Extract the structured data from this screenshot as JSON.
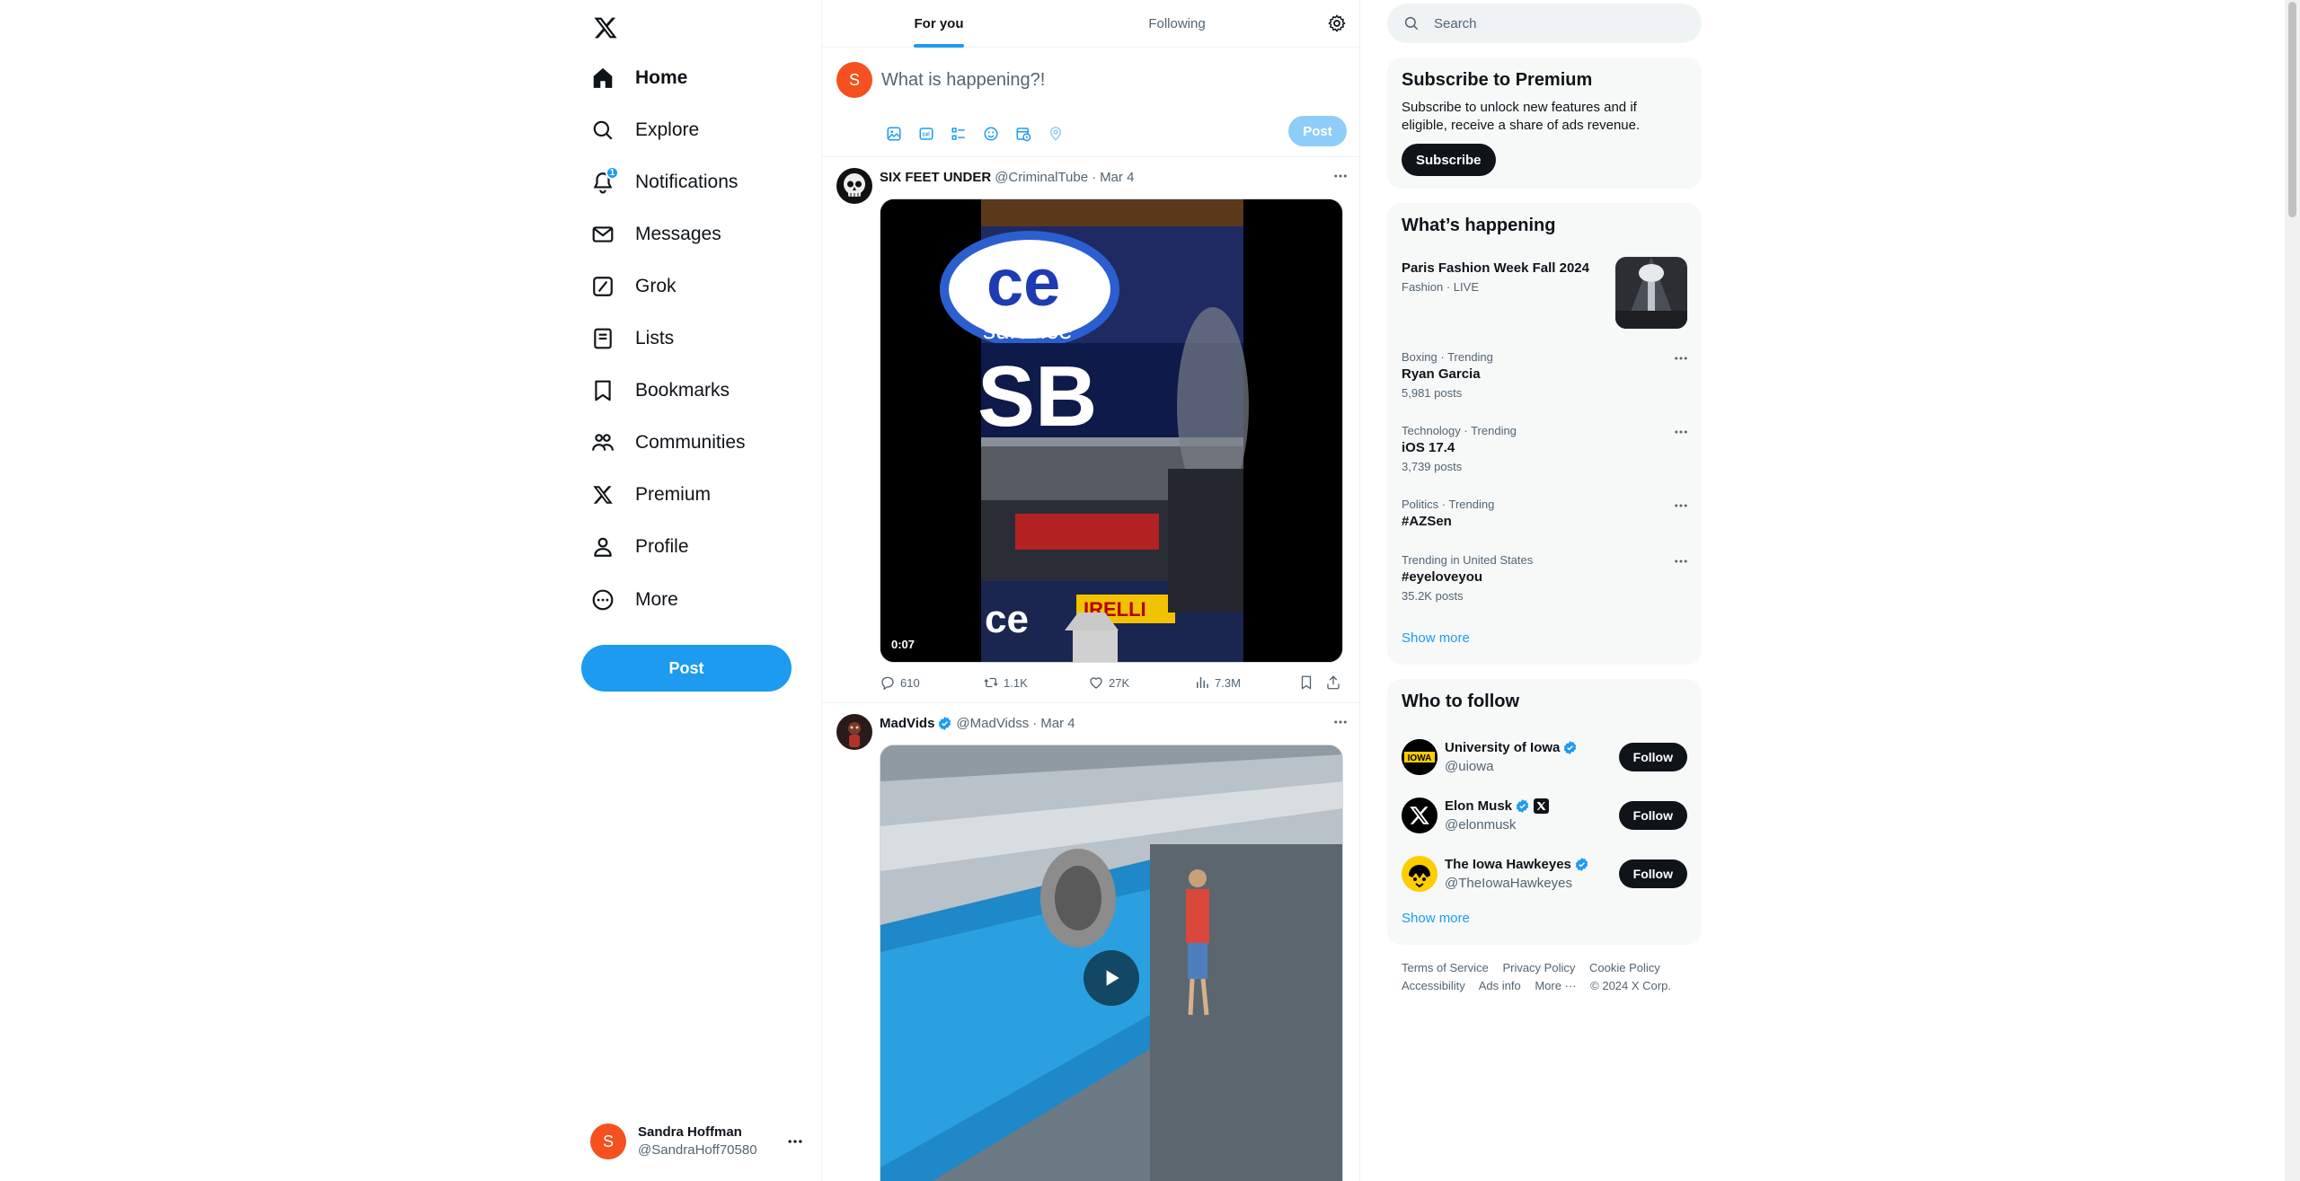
{
  "nav": {
    "items": [
      {
        "label": "Home",
        "icon": "home-icon"
      },
      {
        "label": "Explore",
        "icon": "search-icon"
      },
      {
        "label": "Notifications",
        "icon": "bell-icon",
        "badge": "1"
      },
      {
        "label": "Messages",
        "icon": "envelope-icon"
      },
      {
        "label": "Grok",
        "icon": "grok-icon"
      },
      {
        "label": "Lists",
        "icon": "list-icon"
      },
      {
        "label": "Bookmarks",
        "icon": "bookmark-icon"
      },
      {
        "label": "Communities",
        "icon": "communities-icon"
      },
      {
        "label": "Premium",
        "icon": "x-logo-icon"
      },
      {
        "label": "Profile",
        "icon": "person-icon"
      },
      {
        "label": "More",
        "icon": "more-circle-icon"
      }
    ],
    "post_label": "Post"
  },
  "account": {
    "initial": "S",
    "name": "Sandra Hoffman",
    "handle": "@SandraHoff70580"
  },
  "tabs": {
    "for_you": "For you",
    "following": "Following"
  },
  "composer": {
    "initial": "S",
    "placeholder": "What is happening?!",
    "post_label": "Post"
  },
  "tweets": [
    {
      "name": "SIX FEET UNDER",
      "handle": "@CriminalTube",
      "date": "Mar 4",
      "duration": "0:07",
      "replies": "610",
      "reposts": "1.1K",
      "likes": "27K",
      "views": "7.3M",
      "media_text_top": "ce",
      "media_text_sub": "surance",
      "media_text_mid": "SB",
      "media_text_bottom": "ce",
      "media_text_brand": "IRELLI"
    },
    {
      "name": "MadVids",
      "handle": "@MadVidss",
      "date": "Mar 4"
    }
  ],
  "search": {
    "placeholder": "Search"
  },
  "premium": {
    "title": "Subscribe to Premium",
    "description": "Subscribe to unlock new features and if eligible, receive a share of ads revenue.",
    "button": "Subscribe"
  },
  "happening": {
    "title": "What’s happening",
    "featured": {
      "title": "Paris Fashion Week Fall 2024",
      "meta": "Fashion · LIVE"
    },
    "trends": [
      {
        "meta": "Boxing · Trending",
        "title": "Ryan Garcia",
        "count": "5,981 posts"
      },
      {
        "meta": "Technology · Trending",
        "title": "iOS 17.4",
        "count": "3,739 posts"
      },
      {
        "meta": "Politics · Trending",
        "title": "#AZSen",
        "count": ""
      },
      {
        "meta": "Trending in United States",
        "title": "#eyeloveyou",
        "count": "35.2K posts"
      }
    ],
    "show_more": "Show more"
  },
  "who_to_follow": {
    "title": "Who to follow",
    "accounts": [
      {
        "name": "University of Iowa",
        "handle": "@uiowa",
        "button": "Follow",
        "avatar_text": "IOWA"
      },
      {
        "name": "Elon Musk",
        "handle": "@elonmusk",
        "button": "Follow"
      },
      {
        "name": "The Iowa Hawkeyes",
        "handle": "@TheIowaHawkeyes",
        "button": "Follow"
      }
    ],
    "show_more": "Show more"
  },
  "footer": {
    "links": [
      "Terms of Service",
      "Privacy Policy",
      "Cookie Policy",
      "Accessibility",
      "Ads info",
      "More ···"
    ],
    "copyright": "© 2024 X Corp."
  },
  "colors": {
    "accent": "#1d9bf0",
    "text": "#0f1419",
    "muted": "#536471",
    "avatar": "#f4511e"
  }
}
